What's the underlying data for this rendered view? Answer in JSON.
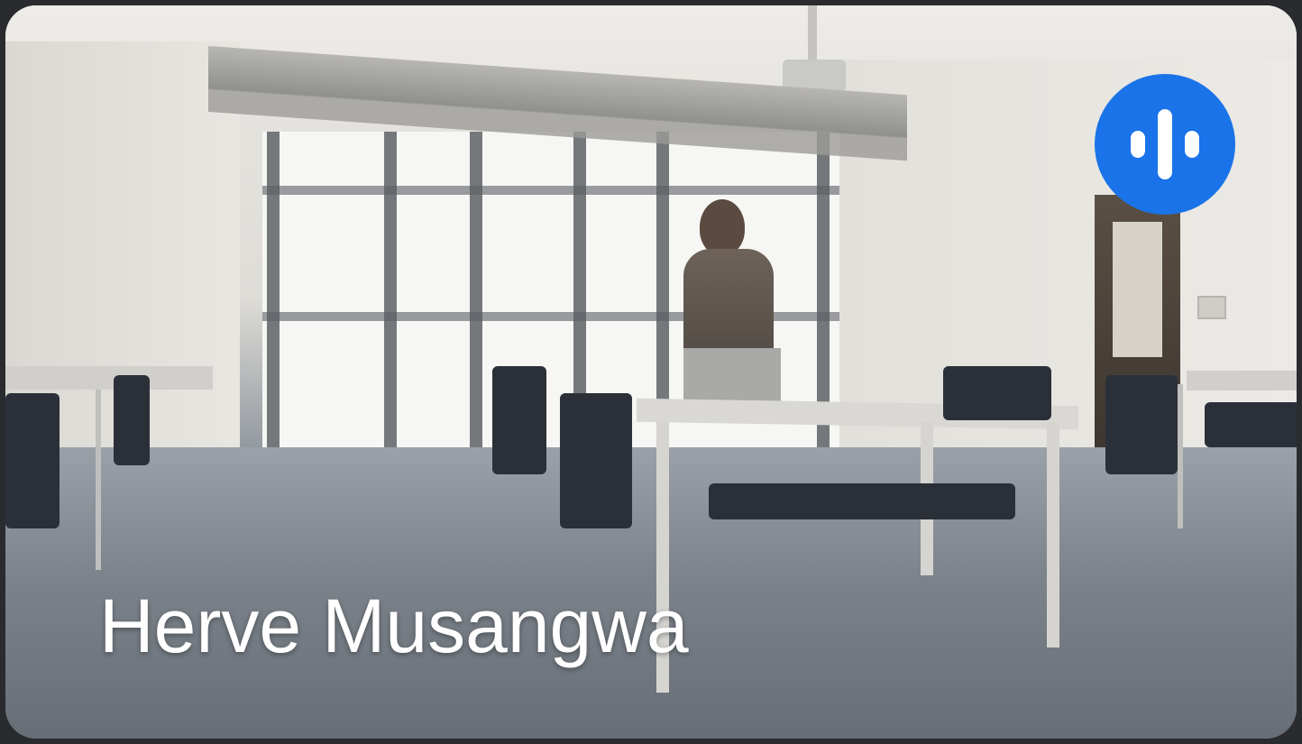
{
  "participant": {
    "name": "Herve Musangwa",
    "status_icon": "speaking-indicator-icon",
    "status_color": "#1a73e8"
  }
}
